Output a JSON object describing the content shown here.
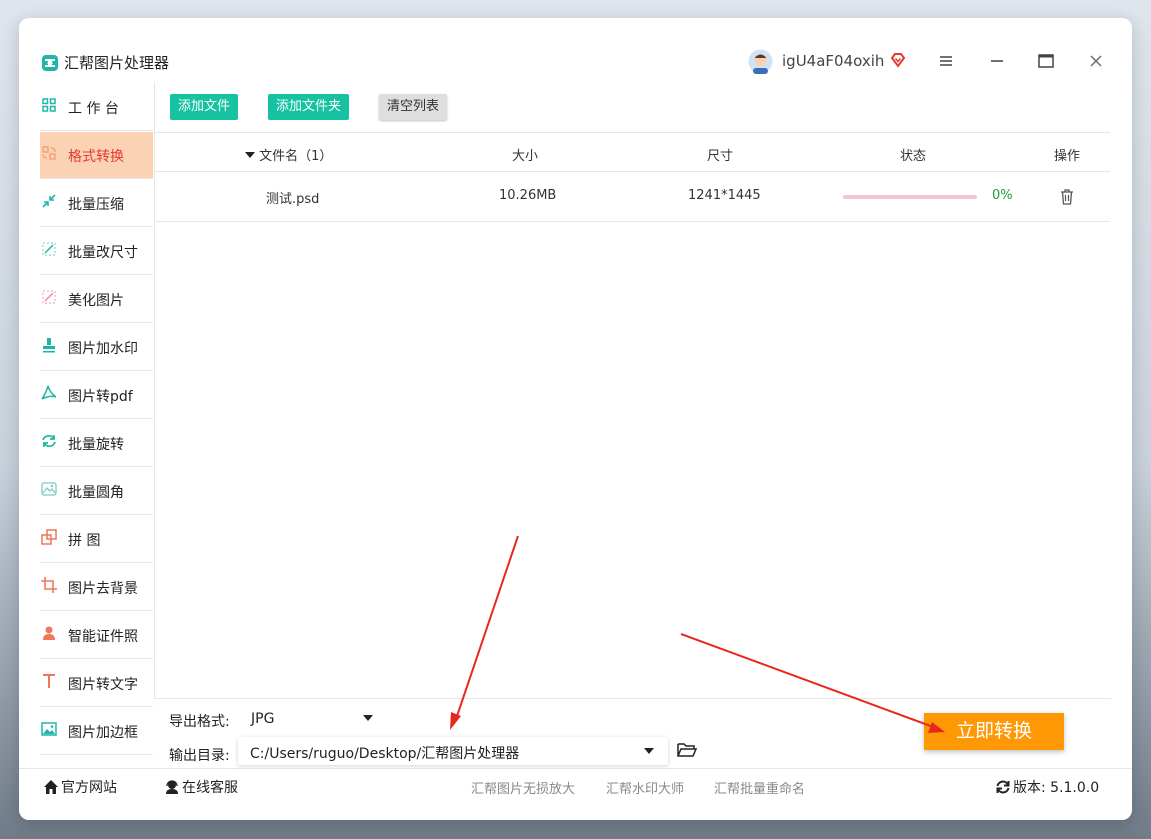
{
  "app": {
    "title": "汇帮图片处理器",
    "username": "igU4aF04oxih"
  },
  "sidebar": {
    "items": [
      {
        "label": "工 作 台",
        "icon": "grid-icon",
        "active": false
      },
      {
        "label": "格式转换",
        "icon": "convert-icon",
        "active": true
      },
      {
        "label": "批量压缩",
        "icon": "compress-icon",
        "active": false
      },
      {
        "label": "批量改尺寸",
        "icon": "resize-icon",
        "active": false
      },
      {
        "label": "美化图片",
        "icon": "beautify-icon",
        "active": false
      },
      {
        "label": "图片加水印",
        "icon": "watermark-icon",
        "active": false
      },
      {
        "label": "图片转pdf",
        "icon": "pdf-icon",
        "active": false
      },
      {
        "label": "批量旋转",
        "icon": "rotate-icon",
        "active": false
      },
      {
        "label": "批量圆角",
        "icon": "rounded-corner-icon",
        "active": false
      },
      {
        "label": "拼    图",
        "icon": "collage-icon",
        "active": false
      },
      {
        "label": "图片去背景",
        "icon": "crop-icon",
        "active": false
      },
      {
        "label": "智能证件照",
        "icon": "person-icon",
        "active": false
      },
      {
        "label": "图片转文字",
        "icon": "text-icon",
        "active": false
      },
      {
        "label": "图片加边框",
        "icon": "frame-icon",
        "active": false
      }
    ]
  },
  "toolbar": {
    "add_file": "添加文件",
    "add_folder": "添加文件夹",
    "clear_list": "清空列表"
  },
  "table": {
    "headers": {
      "filename": "文件名（1）",
      "size": "大小",
      "dimensions": "尺寸",
      "status": "状态",
      "action": "操作"
    },
    "rows": [
      {
        "filename": "测试.psd",
        "size": "10.26MB",
        "dimensions": "1241*1445",
        "progress": 0,
        "progress_text": "0%"
      }
    ]
  },
  "export": {
    "format_label": "导出格式:",
    "format_value": "JPG",
    "output_label": "输出目录:",
    "output_value": "C:/Users/ruguo/Desktop/汇帮图片处理器"
  },
  "convert_button": "立即转换",
  "statusbar": {
    "official_site": "官方网站",
    "online_service": "在线客服",
    "links": [
      "汇帮图片无损放大",
      "汇帮水印大师",
      "汇帮批量重命名"
    ],
    "version": "版本: 5.1.0.0"
  },
  "colors": {
    "accent": "#16c2a1",
    "active_bg": "#fbd2b3",
    "convert": "#ff9805",
    "arrow": "#e8281e"
  }
}
